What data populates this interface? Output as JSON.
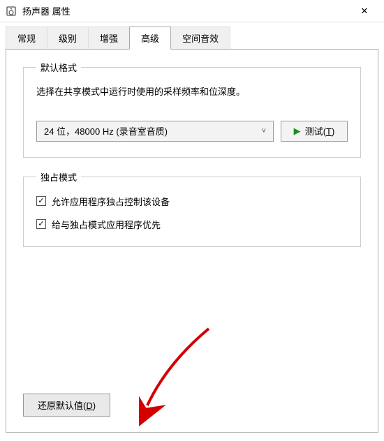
{
  "window": {
    "title": "扬声器 属性"
  },
  "tabs": {
    "general": "常规",
    "levels": "级别",
    "enhance": "增强",
    "advanced": "高级",
    "spatial": "空间音效"
  },
  "defaultFormat": {
    "legend": "默认格式",
    "description": "选择在共享模式中运行时使用的采样频率和位深度。",
    "selected": "24 位，48000 Hz (录音室音质)",
    "testLabel": "测试",
    "testKey": "T"
  },
  "exclusiveMode": {
    "legend": "独占模式",
    "allowExclusive": "允许应用程序独占控制该设备",
    "givePriority": "给与独占模式应用程序优先"
  },
  "restore": {
    "label": "还原默认值",
    "key": "D"
  }
}
